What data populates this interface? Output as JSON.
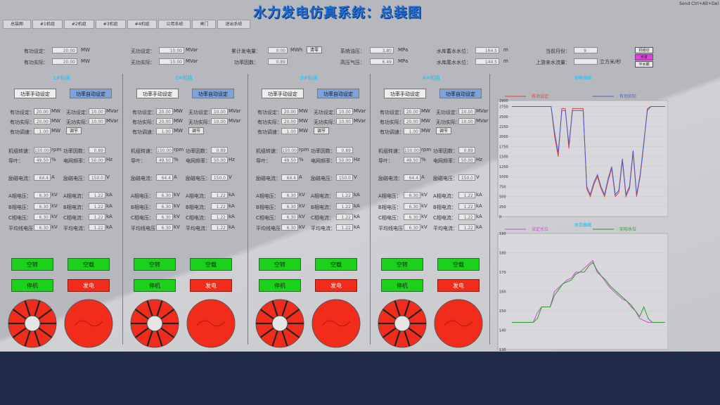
{
  "app": {
    "title": "水力发电仿真系统：总装图",
    "corner_text": "Send Ctrl+Alt+Del"
  },
  "menu": [
    "总装图",
    "#1机组",
    "#2机组",
    "#3机组",
    "#4机组",
    "公用系统",
    "闸门",
    "退出系统"
  ],
  "top": {
    "active_setting": {
      "label": "有功设定：",
      "value": "20.00",
      "unit": "MW"
    },
    "active_actual": {
      "label": "有功实际：",
      "value": "20.00",
      "unit": "MW"
    },
    "reactive_setting": {
      "label": "无功设定：",
      "value": "10.00",
      "unit": "MVar"
    },
    "reactive_actual": {
      "label": "无功实际：",
      "value": "10.00",
      "unit": "MVar"
    },
    "total_gen": {
      "label": "累计发电量：",
      "value": "0.00",
      "unit": "MWh",
      "btn": "清零"
    },
    "power_factor": {
      "label": "功率因数：",
      "value": "0.89"
    },
    "oil_pressure": {
      "label": "系统油压：",
      "value": "3.80",
      "unit": "MPa"
    },
    "hp_air": {
      "label": "高压气压：",
      "value": "6.49",
      "unit": "MPa"
    },
    "reservoir": {
      "label": "水库蓄水水位：",
      "value": "164.5",
      "unit": "m"
    },
    "tailwater": {
      "label": "水库尾水水位：",
      "value": "144.5",
      "unit": "m"
    },
    "date": {
      "label": "当前月份：",
      "value": "9"
    },
    "inflow": {
      "label": "上游来水流量：",
      "unit": "立方米/秒"
    },
    "side_btns": [
      "机组切",
      "开发",
      "平水期"
    ]
  },
  "units": [
    {
      "title": "1#机组",
      "mode1": "功率手动设定",
      "mode2": "功率自动设定",
      "p_set": "20.00",
      "q_set": "10.00",
      "p_act": "20.00",
      "q_act": "10.00",
      "p_step": "1.00",
      "speed": "150.00",
      "pf": "0.89",
      "gv": "49.50",
      "freq": "50.00",
      "ex_i": "64.4",
      "ex_v": "150.0",
      "ua": "6.30",
      "ia": "1.22",
      "ub": "6.30",
      "ib": "1.22",
      "uc": "6.30",
      "ic": "1.22",
      "uavg": "6.30",
      "iavg": "1.22"
    },
    {
      "title": "2#机组",
      "mode1": "功率手动设定",
      "mode2": "功率自动设定",
      "p_set": "20.00",
      "q_set": "10.00",
      "p_act": "20.00",
      "q_act": "10.00",
      "p_step": "1.00",
      "speed": "150.00",
      "pf": "0.89",
      "gv": "49.50",
      "freq": "50.00",
      "ex_i": "64.4",
      "ex_v": "150.0",
      "ua": "6.30",
      "ia": "1.22",
      "ub": "6.30",
      "ib": "1.22",
      "uc": "6.30",
      "ic": "1.22",
      "uavg": "6.30",
      "iavg": "1.22"
    },
    {
      "title": "3#机组",
      "mode1": "功率手动设定",
      "mode2": "功率自动设定",
      "p_set": "20.00",
      "q_set": "10.00",
      "p_act": "20.00",
      "q_act": "10.00",
      "p_step": "1.00",
      "speed": "150.00",
      "pf": "0.89",
      "gv": "49.50",
      "freq": "50.00",
      "ex_i": "64.4",
      "ex_v": "150.0",
      "ua": "6.30",
      "ia": "1.22",
      "ub": "6.30",
      "ib": "1.22",
      "uc": "6.30",
      "ic": "1.22",
      "uavg": "6.30",
      "iavg": "1.22"
    },
    {
      "title": "4#机组",
      "mode1": "功率手动设定",
      "mode2": "功率自动设定",
      "p_set": "20.00",
      "q_set": "10.00",
      "p_act": "20.00",
      "q_act": "10.00",
      "p_step": "1.00",
      "speed": "150.00",
      "pf": "0.89",
      "gv": "49.50",
      "freq": "50.00",
      "ex_i": "64.4",
      "ex_v": "150.0",
      "ua": "6.30",
      "ia": "1.22",
      "ub": "6.30",
      "ib": "1.22",
      "uc": "6.30",
      "ic": "1.22",
      "uavg": "6.30",
      "iavg": "1.22"
    }
  ],
  "labels": {
    "p_set": "有功设定：",
    "q_set": "无功设定：",
    "p_act": "有功实际：",
    "q_act": "无功实际：",
    "p_step": "有功调速：",
    "step_btn": "调节",
    "speed": "机组转速：",
    "pf": "功率因数：",
    "gv": "导叶：",
    "freq": "电网频率：",
    "ex_i": "励磁电流：",
    "ex_v": "励磁电压：",
    "ua": "A相电压：",
    "ia": "A相电流：",
    "ub": "B相电压：",
    "ib": "B相电流：",
    "uc": "C相电压：",
    "ic": "C相电流：",
    "uavg": "平均线电压：",
    "iavg": "平均电流：",
    "u_mw": "MW",
    "u_mvar": "MVar",
    "u_rpm": "rpm",
    "u_pct": "%",
    "u_hz": "Hz",
    "u_a": "A",
    "u_v": "V",
    "u_kv": "kV",
    "u_ka": "kA"
  },
  "buttons": {
    "idle": "空转",
    "empty": "空载",
    "stop": "停机",
    "gen": "发电"
  },
  "chart_data": [
    {
      "type": "line",
      "title": "功率曲线",
      "ylim": [
        0,
        2900
      ],
      "yticks": [
        "2900",
        "2750",
        "2500",
        "2250",
        "2000",
        "1750",
        "1500",
        "1250",
        "1000",
        "750",
        "500",
        "250",
        "0"
      ],
      "series": [
        {
          "name": "有功设定",
          "color": "#e0403a",
          "values": [
            2750,
            2750,
            2750,
            2750,
            2750,
            2750,
            2750,
            2750,
            2750,
            2750,
            2750,
            2750,
            2000,
            1500,
            2700,
            2700,
            1700,
            2700,
            2700,
            2700,
            2700,
            700,
            500,
            800,
            1000,
            700,
            500,
            900,
            1200,
            500,
            600,
            1400,
            500,
            700,
            1600,
            500,
            1000,
            1800,
            2700,
            2750,
            2750,
            2750,
            2750,
            2750
          ]
        },
        {
          "name": "有功实际",
          "color": "#4a5ec8",
          "values": [
            2750,
            2750,
            2750,
            2750,
            2750,
            2750,
            2750,
            2750,
            2750,
            2750,
            2750,
            2750,
            2100,
            1600,
            2650,
            2650,
            1800,
            2650,
            2650,
            2650,
            2650,
            750,
            550,
            850,
            1050,
            750,
            550,
            950,
            1250,
            550,
            650,
            1450,
            550,
            750,
            1650,
            550,
            1050,
            1850,
            2650,
            2750,
            2750,
            2750,
            2750,
            2750
          ]
        }
      ]
    },
    {
      "type": "line",
      "title": "水位曲线",
      "ylim": [
        130,
        190
      ],
      "yticks": [
        "190",
        "180",
        "170",
        "160",
        "150",
        "140",
        "130"
      ],
      "series": [
        {
          "name": "设定水位",
          "color": "#d04ad0",
          "values": [
            144,
            144,
            144,
            144,
            144,
            144,
            149,
            152,
            152,
            152,
            160,
            162,
            164,
            166,
            167,
            170,
            170,
            172,
            174,
            176,
            170,
            168,
            165,
            162,
            160,
            158,
            156,
            155,
            152,
            150,
            146,
            145,
            144,
            144,
            144,
            144,
            144
          ]
        },
        {
          "name": "实际水位",
          "color": "#2a9a2a",
          "values": [
            144,
            144,
            144,
            144,
            144,
            144,
            146,
            152,
            152,
            152,
            158,
            161,
            164,
            165,
            166,
            169,
            170,
            170,
            173,
            175,
            171,
            168,
            166,
            163,
            161,
            159,
            157,
            155,
            153,
            150,
            147,
            152,
            146,
            144,
            144,
            144,
            144
          ]
        }
      ]
    }
  ]
}
